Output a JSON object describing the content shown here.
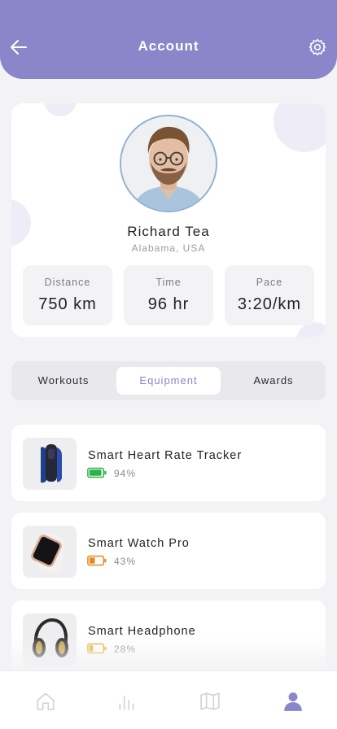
{
  "header": {
    "title": "Account",
    "back_icon": "arrow-left-icon",
    "settings_icon": "gear-icon",
    "color": "#8b86c9"
  },
  "profile": {
    "name": "Richard Tea",
    "location": "Alabama, USA",
    "stats": [
      {
        "label": "Distance",
        "value": "750 km"
      },
      {
        "label": "Time",
        "value": "96 hr"
      },
      {
        "label": "Pace",
        "value": "3:20/km"
      }
    ]
  },
  "tabs": [
    {
      "label": "Workouts",
      "active": false
    },
    {
      "label": "Equipment",
      "active": true
    },
    {
      "label": "Awards",
      "active": false
    }
  ],
  "equipment": [
    {
      "name": "Smart Heart Rate Tracker",
      "battery_text": "94%",
      "battery_level": 0.94,
      "battery_color": "#2bb24c",
      "icon": "fitness-tracker-image"
    },
    {
      "name": "Smart Watch Pro",
      "battery_text": "43%",
      "battery_level": 0.43,
      "battery_color": "#e58a1f",
      "icon": "smart-watch-image"
    },
    {
      "name": "Smart Headphone",
      "battery_text": "28%",
      "battery_level": 0.28,
      "battery_color": "#e0b020",
      "icon": "headphone-image"
    }
  ],
  "bottom_nav": [
    {
      "icon": "home-icon",
      "active": false
    },
    {
      "icon": "bar-chart-icon",
      "active": false
    },
    {
      "icon": "map-icon",
      "active": false
    },
    {
      "icon": "user-icon",
      "active": true
    }
  ]
}
